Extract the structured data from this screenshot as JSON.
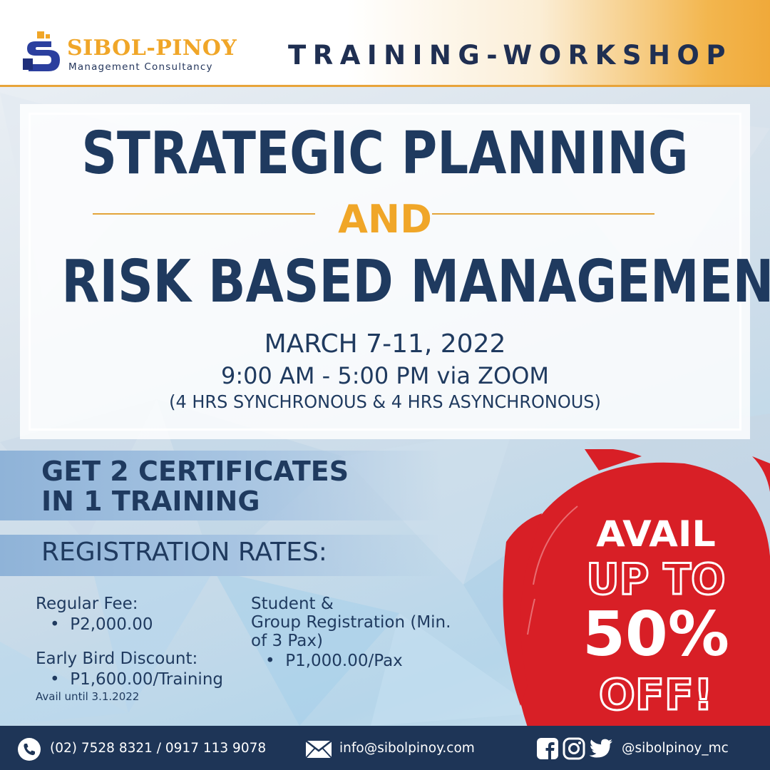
{
  "brand": {
    "name": "SIBOL-PINOY",
    "subtitle": "Management Consultancy",
    "colors": {
      "navy": "#1f3a5f",
      "gold": "#f0a628",
      "red": "#d81f26"
    }
  },
  "header": {
    "title": "TRAINING-WORKSHOP"
  },
  "event": {
    "title_line1": "STRATEGIC PLANNING",
    "connector": "AND",
    "title_line2": "RISK BASED MANAGEMENT",
    "date": "MARCH 7-11, 2022",
    "time": "9:00 AM - 5:00 PM via ZOOM",
    "format": "(4 HRS SYNCHRONOUS & 4 HRS ASYNCHRONOUS)"
  },
  "certificates": {
    "line1": "GET 2 CERTIFICATES",
    "line2": "IN 1 TRAINING"
  },
  "rates": {
    "title": "REGISTRATION RATES:",
    "regular": {
      "label": "Regular Fee:",
      "price": "P2,000.00"
    },
    "early_bird": {
      "label": "Early Bird Discount:",
      "price": "P1,600.00/Training",
      "note": "Avail until 3.1.2022"
    },
    "group": {
      "label_line1": "Student &",
      "label_line2": "Group Registration (Min.",
      "label_line3": "of 3 Pax)",
      "price": "P1,000.00/Pax"
    }
  },
  "promo": {
    "line1": "AVAIL",
    "line2": "UP TO",
    "line3": "50%",
    "line4": "OFF!"
  },
  "footer": {
    "phone_icon": "phone-icon",
    "phone": "(02) 7528 8321 / 0917 113 9078",
    "email_icon": "envelope-icon",
    "email": "info@sibolpinoy.com",
    "social_icons": [
      "facebook-icon",
      "instagram-icon",
      "twitter-icon"
    ],
    "handle": "@sibolpinoy_mc"
  }
}
